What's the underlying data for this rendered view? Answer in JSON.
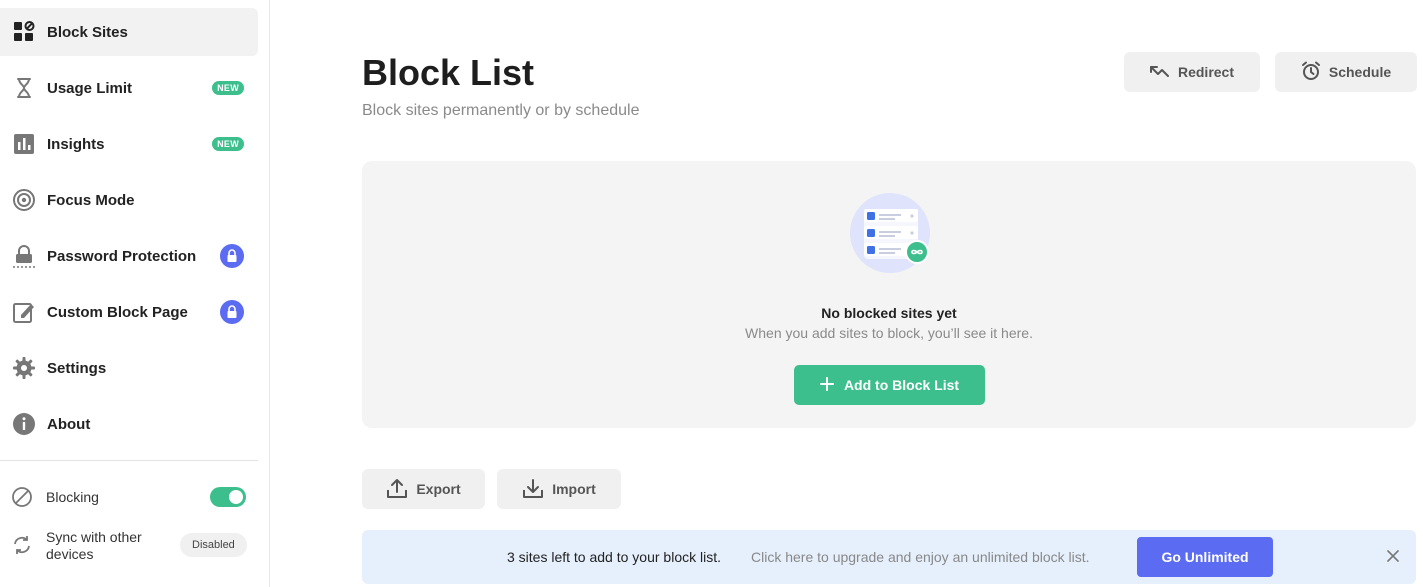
{
  "sidebar": {
    "items": [
      {
        "label": "Block Sites",
        "icon": "block-sites-icon",
        "active": true
      },
      {
        "label": "Usage Limit",
        "icon": "hourglass-icon",
        "badge": "NEW"
      },
      {
        "label": "Insights",
        "icon": "bar-chart-icon",
        "badge": "NEW"
      },
      {
        "label": "Focus Mode",
        "icon": "target-icon"
      },
      {
        "label": "Password Protection",
        "icon": "lock-icon",
        "locked": true
      },
      {
        "label": "Custom Block Page",
        "icon": "edit-page-icon",
        "locked": true
      },
      {
        "label": "Settings",
        "icon": "gear-icon"
      },
      {
        "label": "About",
        "icon": "info-icon"
      }
    ],
    "blocking_label": "Blocking",
    "blocking_enabled": true,
    "sync_label": "Sync with other devices",
    "sync_status": "Disabled"
  },
  "header": {
    "title": "Block List",
    "subtitle": "Block sites permanently or by schedule",
    "redirect_label": "Redirect",
    "schedule_label": "Schedule"
  },
  "empty_state": {
    "title": "No blocked sites yet",
    "subtitle": "When you add sites to block, you’ll see it here.",
    "add_button_label": "Add to Block List"
  },
  "actions": {
    "export_label": "Export",
    "import_label": "Import"
  },
  "banner": {
    "main_text": "3 sites left to add to your block list.",
    "sub_text": "Click here to upgrade and enjoy an unlimited block list.",
    "cta_label": "Go Unlimited"
  },
  "colors": {
    "accent_green": "#3dbf8d",
    "accent_blue": "#5b6bf2",
    "banner_bg": "#e6f0fc"
  }
}
